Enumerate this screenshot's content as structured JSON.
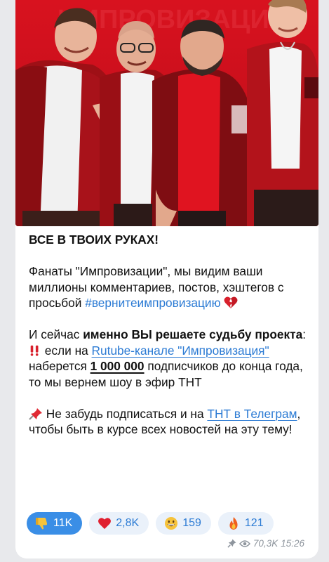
{
  "post": {
    "title": "ВСЕ В ТВОИХ РУКАХ!",
    "para1_text": "Фанаты \"Импровизации\", мы видим ваши миллионы комментариев, постов, хэштегов с просьбой",
    "hashtag": "#вернитеимпровизацию",
    "para2_prefix": "И сейчас ",
    "para2_bold": "именно ВЫ решаете судьбу проекта",
    "para2_colon": ":",
    "para3_prefix": " если на ",
    "para3_link": "Rutube-канале \"Импровизация\" ",
    "para3_mid": "наберется ",
    "para3_count": "1 000 000",
    "para3_suffix": " подписчиков до конца года, то мы вернем шоу в эфир ТНТ",
    "para4_prefix": " Не забудь подписаться и на ",
    "para4_link": "ТНТ в Телеграм",
    "para4_suffix": ", чтобы быть в курсе всех новостей на эту тему!"
  },
  "reactions": [
    {
      "icon": "thumbs-down-icon",
      "count": "11K",
      "active": true
    },
    {
      "icon": "red-heart-icon",
      "count": "2,8K",
      "active": false
    },
    {
      "icon": "grinning-face-icon",
      "count": "159",
      "active": false
    },
    {
      "icon": "fire-icon",
      "count": "121",
      "active": false
    }
  ],
  "meta": {
    "views": "70,3K",
    "time": "15:26",
    "icons": [
      "pin-icon",
      "eye-icon"
    ]
  },
  "photo": {
    "background_text": "ИМПРОВИЗАЦИЯ"
  },
  "colors": {
    "link": "#2c7bd4",
    "active_reaction": "#3a8ee6",
    "reaction_bg": "#eaf1fa",
    "photo_red": "#d8121f"
  }
}
